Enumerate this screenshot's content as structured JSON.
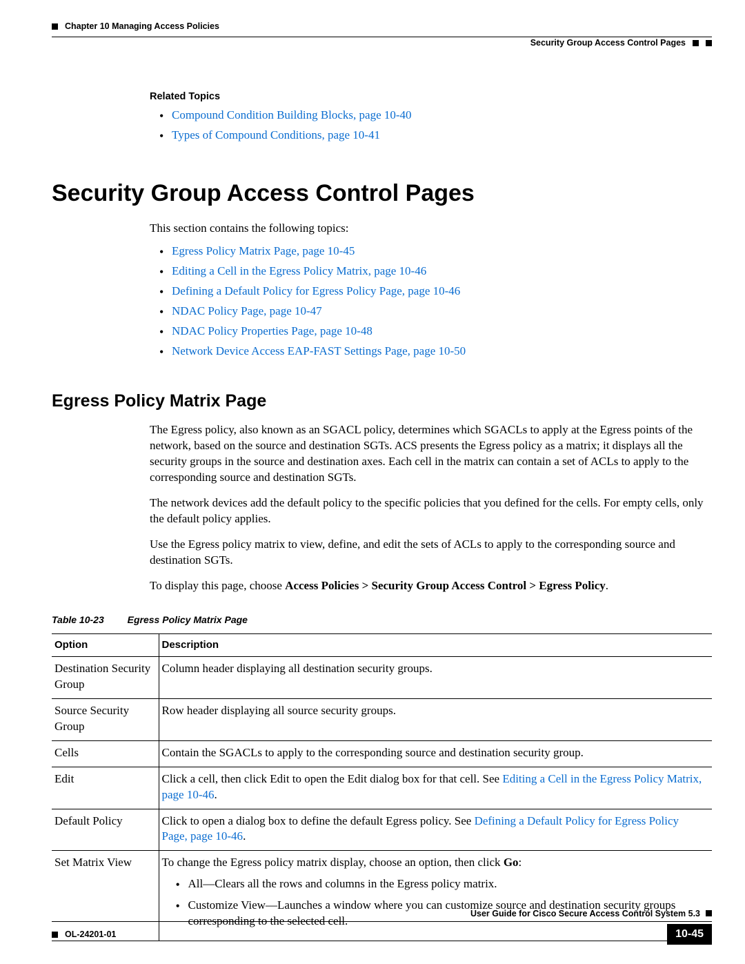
{
  "header": {
    "chapter": "Chapter 10    Managing Access Policies",
    "section": "Security Group Access Control Pages"
  },
  "related": {
    "title": "Related Topics",
    "items": [
      "Compound Condition Building Blocks, page 10-40",
      "Types of Compound Conditions, page 10-41"
    ]
  },
  "h1": "Security Group Access Control Pages",
  "intro": "This section contains the following topics:",
  "topics": [
    "Egress Policy Matrix Page, page 10-45",
    "Editing a Cell in the Egress Policy Matrix, page 10-46",
    "Defining a Default Policy for Egress Policy Page, page 10-46",
    "NDAC Policy Page, page 10-47",
    "NDAC Policy Properties Page, page 10-48",
    "Network Device Access EAP-FAST Settings Page, page 10-50"
  ],
  "h2": "Egress Policy Matrix Page",
  "paras": {
    "p1": "The Egress policy, also known as an SGACL policy, determines which SGACLs to apply at the Egress points of the network, based on the source and destination SGTs. ACS presents the Egress policy as a matrix; it displays all the security groups in the source and destination axes. Each cell in the matrix can contain a set of ACLs to apply to the corresponding source and destination SGTs.",
    "p2": "The network devices add the default policy to the specific policies that you defined for the cells. For empty cells, only the default policy applies.",
    "p3": "Use the Egress policy matrix to view, define, and edit the sets of ACLs to apply to the corresponding source and destination SGTs.",
    "p4a": "To display this page, choose ",
    "p4b": "Access Policies > Security Group Access Control > Egress Policy",
    "p4c": "."
  },
  "table": {
    "caption_label": "Table 10-23",
    "caption_title": "Egress Policy Matrix Page",
    "head_option": "Option",
    "head_desc": "Description",
    "rows": {
      "r1o": "Destination Security Group",
      "r1d": "Column header displaying all destination security groups.",
      "r2o": "Source Security Group",
      "r2d": "Row header displaying all source security groups.",
      "r3o": "Cells",
      "r3d": "Contain the SGACLs to apply to the corresponding source and destination security group.",
      "r4o": "Edit",
      "r4d_a": "Click a cell, then click Edit to open the Edit dialog box for that cell. See ",
      "r4d_link": "Editing a Cell in the Egress Policy Matrix, page 10-46",
      "r4d_b": ".",
      "r5o": "Default Policy",
      "r5d_a": "Click to open a dialog box to define the default Egress policy. See ",
      "r5d_link": "Defining a Default Policy for Egress Policy Page, page 10-46",
      "r5d_b": ".",
      "r6o": "Set Matrix View",
      "r6d_intro_a": "To change the Egress policy matrix display, choose an option, then click ",
      "r6d_intro_b": "Go",
      "r6d_intro_c": ":",
      "r6d_b1": "All—Clears all the rows and columns in the Egress policy matrix.",
      "r6d_b2": "Customize View—Launches a window where you can customize source and destination security groups corresponding to the selected cell."
    }
  },
  "footer": {
    "guide": "User Guide for Cisco Secure Access Control System 5.3",
    "doc": "OL-24201-01",
    "page": "10-45"
  }
}
